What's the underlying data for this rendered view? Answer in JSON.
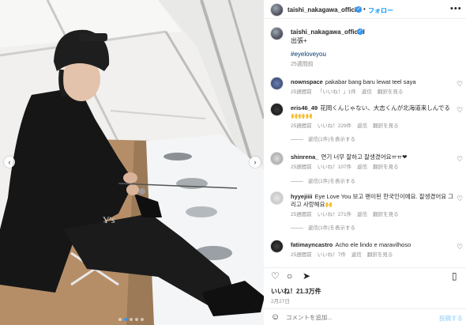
{
  "header": {
    "username": "taishi_nakagawa_official",
    "dot": "•",
    "follow_label": "フォロー",
    "more_icon": "more-horizontal-icon"
  },
  "caption": {
    "username": "taishi_nakagawa_official",
    "text": "出張+",
    "hashtag": "#eyeloveyou",
    "time": "25週間前"
  },
  "comments": [
    {
      "username": "nownspace",
      "text": "pakabar bang baru lewat teel saya",
      "time": "25週間前",
      "likes": "「いいね！」1件",
      "reply": "返信",
      "translate": "翻訳を見る",
      "replies_label": ""
    },
    {
      "username": "eris46_49",
      "text": "花岡くんじゃない、大志くんが北海道来しんでる🙌🙌🙌",
      "time": "25週間前",
      "likes": "いいね！229件",
      "reply": "返信",
      "translate": "翻訳を見る",
      "replies_label": "返信(1件)を表示する"
    },
    {
      "username": "shinrena_",
      "text": "연기 너무 잘하고 잘생겼어요ㅠㅠ❤",
      "time": "25週間前",
      "likes": "いいね！107件",
      "reply": "返信",
      "translate": "翻訳を見る",
      "replies_label": "返信(1件)を表示する"
    },
    {
      "username": "hyyejiiii",
      "text": "Eye Love You 보고 팬이된 한국인이에요. 잘생겼어요 그리고 사랑해요🙌",
      "time": "25週間前",
      "likes": "いいね！271件",
      "reply": "返信",
      "translate": "翻訳を見る",
      "replies_label": "返信(1件)を表示する"
    },
    {
      "username": "fatimayncastro",
      "text": "Acho ele lindo e maravilhoso",
      "time": "25週間前",
      "likes": "いいね！7件",
      "reply": "返信",
      "translate": "翻訳を見る",
      "replies_label": ""
    }
  ],
  "actions": {
    "like_icon": "heart-icon",
    "comment_icon": "comment-icon",
    "share_icon": "share-icon",
    "save_icon": "bookmark-icon"
  },
  "likes_text": "いいね！21.3万件",
  "date_text": "2月27日",
  "composer": {
    "emoji_icon": "emoji-icon",
    "placeholder": "コメントを追加...",
    "post_label": "投稿する"
  },
  "colors": {
    "accent": "#0095f6",
    "verified": "#3897f0",
    "muted": "#8e8e8e",
    "text": "#262626"
  }
}
